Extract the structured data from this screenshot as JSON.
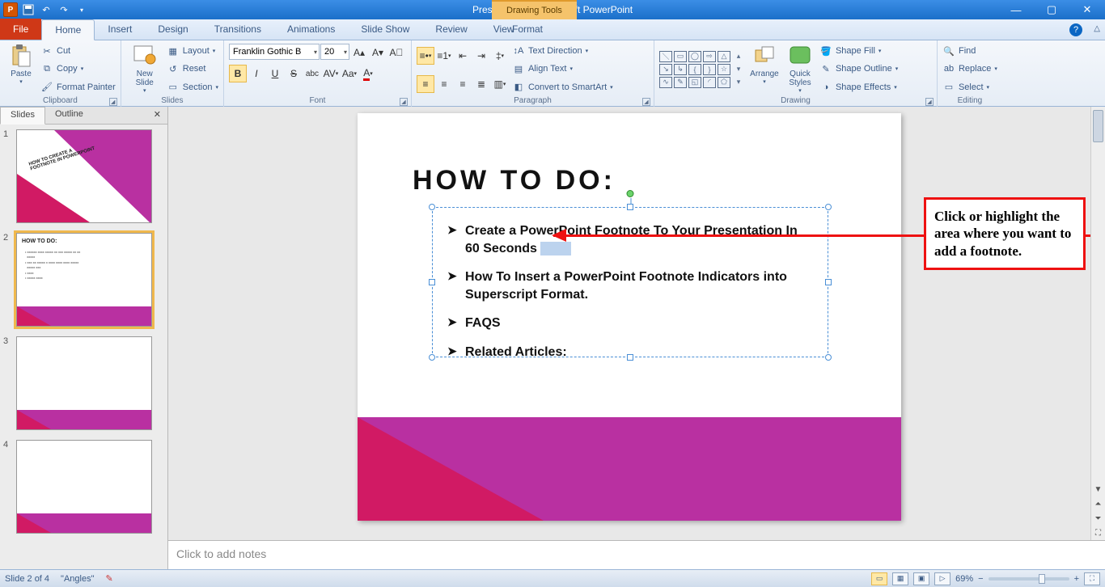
{
  "titlebar": {
    "app_initial": "P",
    "title": "Presentation1 - Microsoft PowerPoint",
    "drawing_tools": "Drawing Tools"
  },
  "tabs": {
    "file": "File",
    "home": "Home",
    "insert": "Insert",
    "design": "Design",
    "transitions": "Transitions",
    "animations": "Animations",
    "slideshow": "Slide Show",
    "review": "Review",
    "view": "View",
    "format": "Format"
  },
  "ribbon": {
    "clipboard": {
      "paste": "Paste",
      "cut": "Cut",
      "copy": "Copy",
      "format_painter": "Format Painter",
      "label": "Clipboard"
    },
    "slides": {
      "new_slide": "New\nSlide",
      "layout": "Layout",
      "reset": "Reset",
      "section": "Section",
      "label": "Slides"
    },
    "font": {
      "name": "Franklin Gothic B",
      "size": "20",
      "label": "Font"
    },
    "paragraph": {
      "text_direction": "Text Direction",
      "align_text": "Align Text",
      "convert_smartart": "Convert to SmartArt",
      "label": "Paragraph"
    },
    "drawing": {
      "arrange": "Arrange",
      "quick_styles": "Quick\nStyles",
      "shape_fill": "Shape Fill",
      "shape_outline": "Shape Outline",
      "shape_effects": "Shape Effects",
      "label": "Drawing"
    },
    "editing": {
      "find": "Find",
      "replace": "Replace",
      "select": "Select",
      "label": "Editing"
    }
  },
  "thumbs": {
    "slides_tab": "Slides",
    "outline_tab": "Outline",
    "t1_text": "HOW TO CREATE A\nFOOTNOTE IN POWERPOINT",
    "t2_title": "HOW TO DO:"
  },
  "slide": {
    "title": "HOW TO DO:",
    "b1": "Create a PowerPoint Footnote To Your Presentation In 60 Seconds",
    "b2": "How To Insert a PowerPoint Footnote Indicators into Superscript Format.",
    "b3": "FAQS",
    "b4": "Related Articles:"
  },
  "callout": "Click or highlight the area where you want to add a footnote.",
  "notes_placeholder": "Click to add notes",
  "status": {
    "slide_of": "Slide 2 of 4",
    "theme": "\"Angles\"",
    "zoom": "69%"
  }
}
